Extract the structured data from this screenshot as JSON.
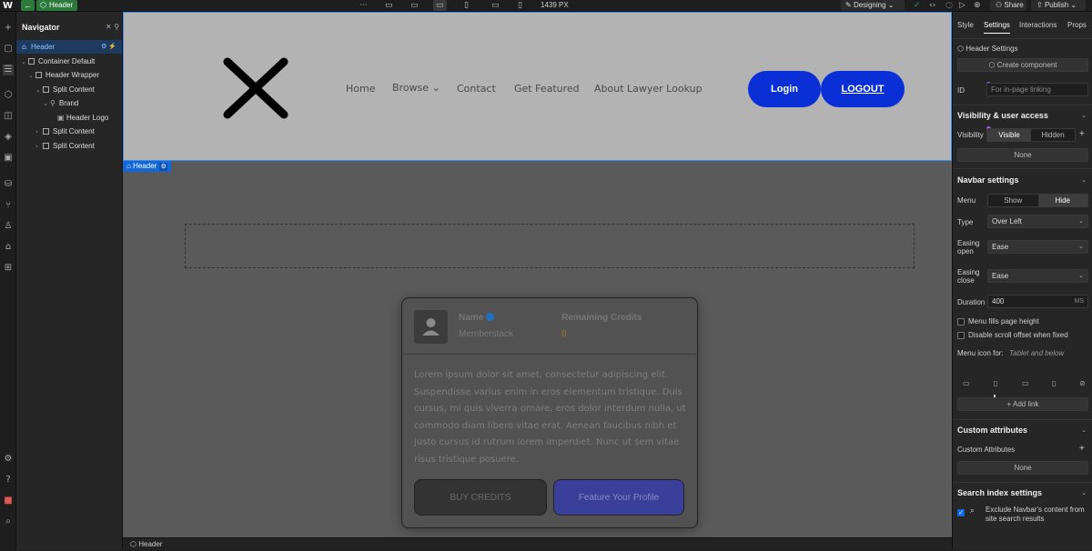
{
  "topbar": {
    "logo": "W",
    "back_icon": "arrow-left-icon",
    "selected_element": "Header",
    "more": "···",
    "viewport_width": "1439 PX",
    "mode": "Designing",
    "share": "Share",
    "publish": "Publish"
  },
  "navigator": {
    "title": "Navigator",
    "items": [
      {
        "label": "Header"
      },
      {
        "label": "Container Default"
      },
      {
        "label": "Header Wrapper"
      },
      {
        "label": "Split Content"
      },
      {
        "label": "Brand"
      },
      {
        "label": "Header Logo"
      },
      {
        "label": "Split Content"
      },
      {
        "label": "Split Content"
      }
    ]
  },
  "site": {
    "nav_links": [
      "Home",
      "Browse",
      "Contact",
      "Get Featured",
      "About Lawyer Lookup"
    ],
    "login": "Login",
    "logout": "LOGOUT",
    "selection_tag": "Header"
  },
  "card": {
    "name_label": "Name",
    "name_value": "Memberstack",
    "credits_label": "Remaining Credits",
    "credits_value": "0",
    "body": "Lorem ipsum dolor sit amet, consectetur adipiscing elit. Suspendisse varius enim in eros elementum tristique. Duis cursus, mi quis viverra ornare, eros dolor interdum nulla, ut commodo diam libero vitae erat. Aenean faucibus nibh et justo cursus id rutrum lorem imperdiet. Nunc ut sem vitae risus tristique posuere.",
    "buy_button": "BUY CREDITS",
    "feature_button": "Feature Your Profile"
  },
  "breadcrumb": {
    "item": "Header"
  },
  "right_panel": {
    "tabs": [
      "Style",
      "Settings",
      "Interactions",
      "Props"
    ],
    "header_settings": "Header Settings",
    "create_component": "Create component",
    "id_label": "ID",
    "id_placeholder": "For in-page linking",
    "visibility_section": "Visibility & user access",
    "visibility_label": "Visibility",
    "visible": "Visible",
    "hidden": "Hidden",
    "none": "None",
    "navbar_section": "Navbar settings",
    "menu_label": "Menu",
    "show": "Show",
    "hide": "Hide",
    "type_label": "Type",
    "type_value": "Over Left",
    "easing_open_label": "Easing open",
    "easing_open_value": "Ease",
    "easing_close_label": "Easing close",
    "easing_close_value": "Ease",
    "duration_label": "Duration",
    "duration_value": "400",
    "duration_unit": "MS",
    "fills_page": "Menu fills page height",
    "disable_scroll": "Disable scroll offset when fixed",
    "menu_icon_for": "Menu icon for:",
    "menu_icon_value": "Tablet and below",
    "add_link": "+ Add link",
    "custom_attributes_section": "Custom attributes",
    "custom_attributes_label": "Custom Attributes",
    "custom_none": "None",
    "search_section": "Search index settings",
    "exclude_label": "Exclude Navbar's content from site search results"
  },
  "colors": {
    "accent": "#1268d8",
    "header_bg": "#b3b3b3",
    "button_blue": "#0a2fd6",
    "publish_green": "#2b7a3b"
  }
}
